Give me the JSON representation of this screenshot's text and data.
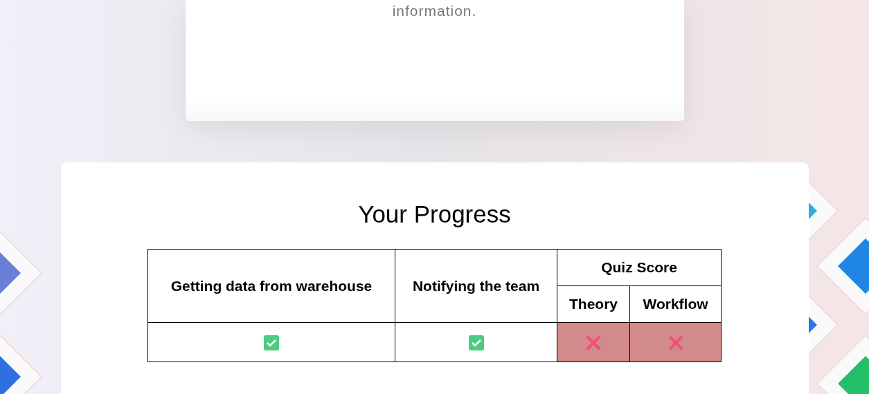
{
  "info_card": {
    "text": "information."
  },
  "progress": {
    "title": "Your Progress",
    "columns": [
      {
        "label": "Getting data from warehouse"
      },
      {
        "label": "Notifying the team"
      }
    ],
    "group": {
      "label": "Quiz Score",
      "columns": [
        {
          "label": "Theory"
        },
        {
          "label": "Workflow"
        }
      ]
    },
    "results": [
      {
        "passed": true
      },
      {
        "passed": true
      },
      {
        "passed": false
      },
      {
        "passed": false
      }
    ]
  }
}
